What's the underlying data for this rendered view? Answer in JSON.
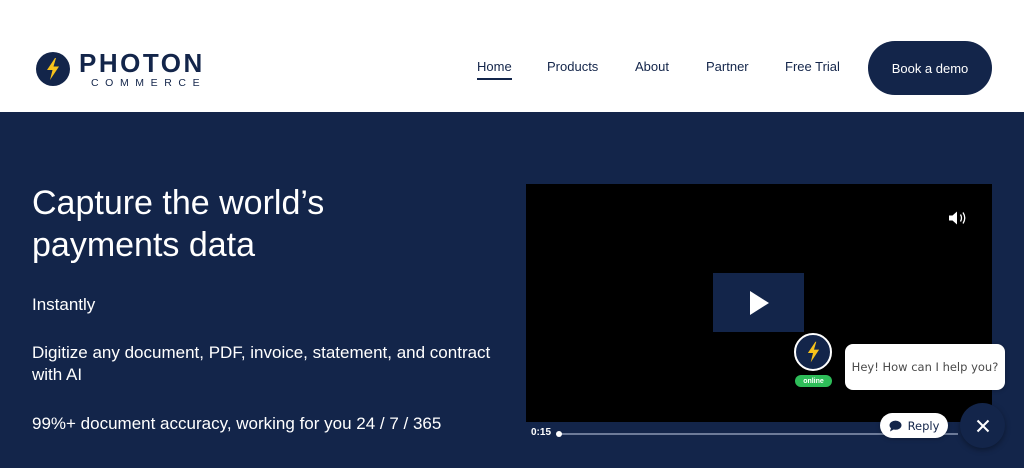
{
  "header": {
    "logo": {
      "name": "PHOTON",
      "sub": "COMMERCE",
      "icon": "bolt-icon"
    },
    "nav": [
      {
        "label": "Home",
        "active": true
      },
      {
        "label": "Products",
        "active": false
      },
      {
        "label": "About",
        "active": false
      },
      {
        "label": "Partner",
        "active": false
      },
      {
        "label": "Free Trial",
        "active": false
      }
    ],
    "cta_label": "Book a demo"
  },
  "hero": {
    "title": "Capture the world’s payments data",
    "line1": "Instantly",
    "line2": "Digitize any document, PDF, invoice, statement, and contract with AI",
    "line3": "99%+ document accuracy, working for you 24 / 7 / 365"
  },
  "video": {
    "current_time": "0:15",
    "icons": {
      "play": "play-icon",
      "volume": "volume-icon"
    }
  },
  "chat": {
    "status": "online",
    "greeting": "Hey! How can I help you?",
    "reply_label": "Reply"
  },
  "colors": {
    "brand_navy": "#13254a",
    "accent_yellow": "#f7c21b",
    "online_green": "#2ebd59"
  }
}
